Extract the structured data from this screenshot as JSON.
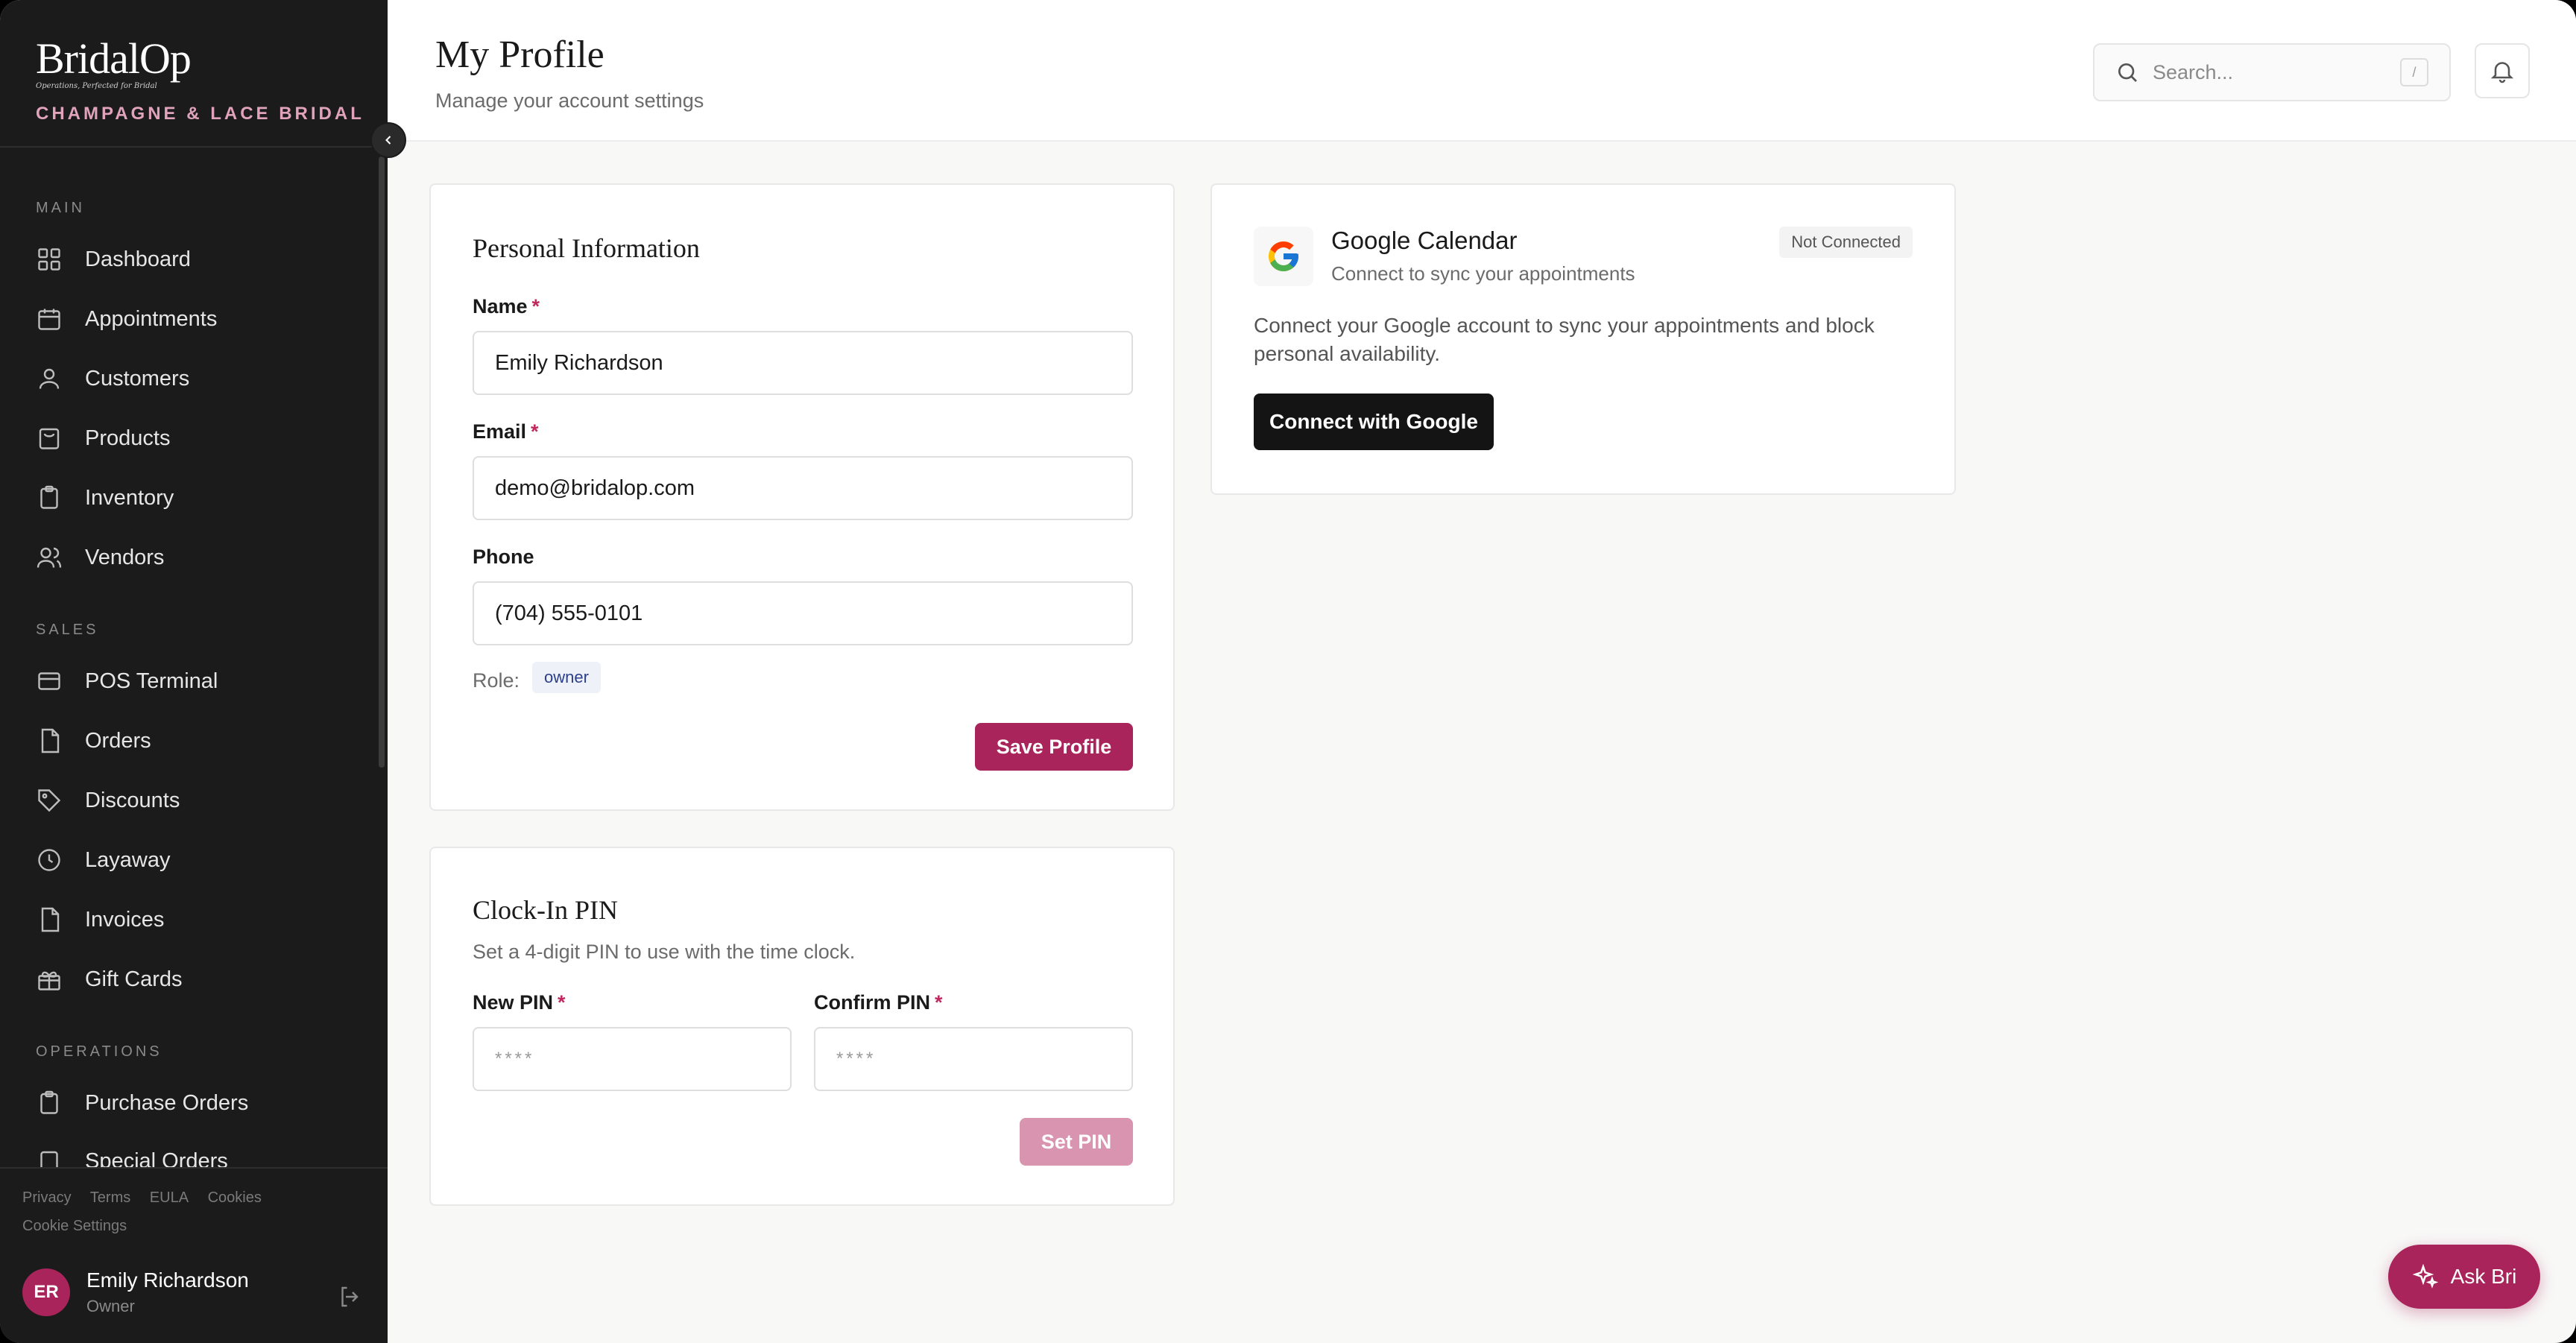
{
  "brand": {
    "logo": "BridalOp",
    "tagline": "Operations, Perfected for Bridal",
    "store": "CHAMPAGNE & LACE BRIDAL"
  },
  "sidebar": {
    "sections": [
      {
        "label": "MAIN",
        "items": [
          "Dashboard",
          "Appointments",
          "Customers",
          "Products",
          "Inventory",
          "Vendors"
        ]
      },
      {
        "label": "SALES",
        "items": [
          "POS Terminal",
          "Orders",
          "Discounts",
          "Layaway",
          "Invoices",
          "Gift Cards"
        ]
      },
      {
        "label": "OPERATIONS",
        "items": [
          "Purchase Orders",
          "Special Orders"
        ]
      }
    ],
    "legal": [
      "Privacy",
      "Terms",
      "EULA",
      "Cookies"
    ],
    "cookie_settings": "Cookie Settings",
    "user": {
      "initials": "ER",
      "name": "Emily Richardson",
      "role": "Owner"
    }
  },
  "header": {
    "title": "My Profile",
    "subtitle": "Manage your account settings",
    "search_placeholder": "Search...",
    "search_shortcut": "/"
  },
  "personal": {
    "title": "Personal Information",
    "name_label": "Name",
    "name_value": "Emily Richardson",
    "email_label": "Email",
    "email_value": "demo@bridalop.com",
    "phone_label": "Phone",
    "phone_value": "(704) 555-0101",
    "role_label": "Role:",
    "role_value": "owner",
    "save_label": "Save Profile",
    "required_mark": "*"
  },
  "pin": {
    "title": "Clock-In PIN",
    "description": "Set a 4-digit PIN to use with the time clock.",
    "new_label": "New PIN",
    "confirm_label": "Confirm PIN",
    "placeholder": "****",
    "set_label": "Set PIN"
  },
  "google": {
    "title": "Google Calendar",
    "subtitle": "Connect to sync your appointments",
    "status": "Not Connected",
    "description": "Connect your Google account to sync your appointments and block personal availability.",
    "button": "Connect with Google"
  },
  "assistant": {
    "label": "Ask Bri"
  },
  "colors": {
    "accent": "#a8245a",
    "sidebar": "#1b1b1b"
  }
}
